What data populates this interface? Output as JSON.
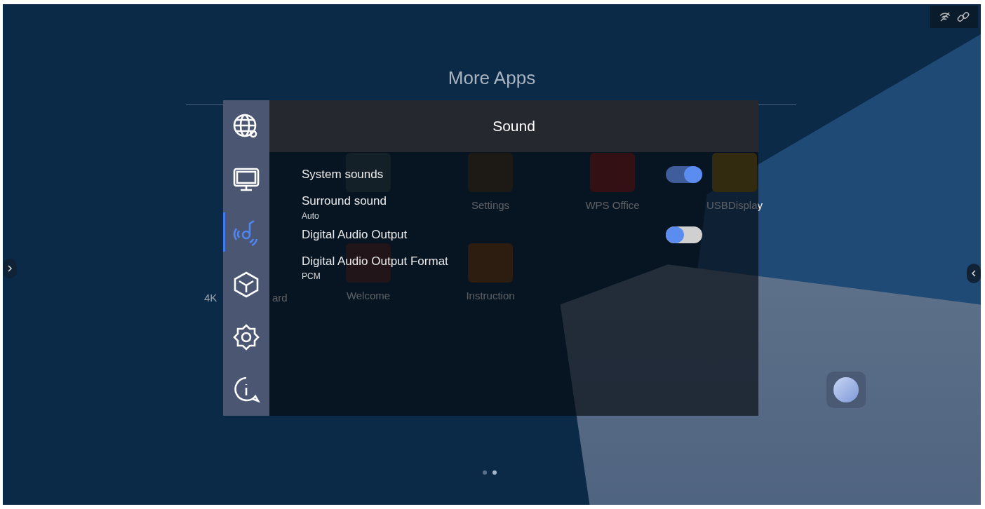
{
  "home": {
    "title": "More Apps",
    "apps": [
      {
        "kind": "folder"
      },
      {
        "kind": "gear",
        "label": "Settings"
      },
      {
        "kind": "wps",
        "label": "WPS Office"
      },
      {
        "kind": "display",
        "label": "USBDisplay"
      },
      {
        "kind": "hand",
        "label": "Welcome"
      },
      {
        "kind": "book",
        "label": "Instruction"
      }
    ],
    "fragments": [
      "4K",
      "ard"
    ],
    "page_dots": [
      {
        "selected": false
      },
      {
        "selected": true
      }
    ]
  },
  "dialog": {
    "title": "Sound",
    "nav": [
      {
        "kind": "network",
        "selected": false
      },
      {
        "kind": "display",
        "selected": false
      },
      {
        "kind": "sound",
        "selected": true
      },
      {
        "kind": "cube",
        "selected": false
      },
      {
        "kind": "gear",
        "selected": false
      },
      {
        "kind": "info",
        "selected": false
      }
    ],
    "settings": [
      {
        "kind": "switch",
        "label": "System sounds",
        "on": true
      },
      {
        "kind": "choice",
        "label": "Surround sound",
        "value": "Auto"
      },
      {
        "kind": "switch",
        "label": "Digital Audio Output",
        "on": false
      },
      {
        "kind": "choice",
        "label": "Digital Audio Output Format",
        "value": "PCM"
      }
    ]
  }
}
